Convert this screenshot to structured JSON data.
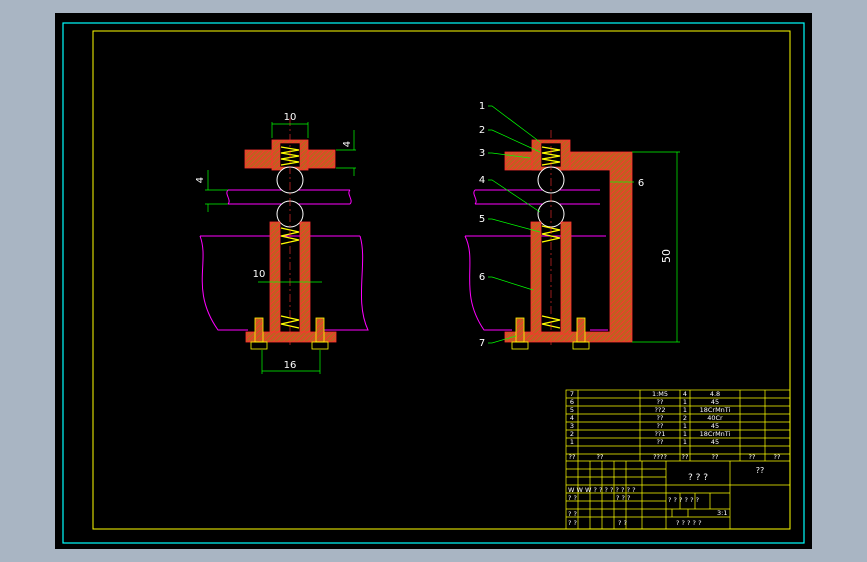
{
  "colors": {
    "app_bg": "#a9b5c3",
    "canvas": "#000000",
    "frame_outer": "#00ffff",
    "frame_inner": "#ffff00",
    "body_fill": "#c06020",
    "hatch": "#ff3030",
    "spring": "#ffff00",
    "ball_outline": "#ffffff",
    "workpiece": "#ff00ff",
    "dimension": "#00ff00",
    "leader": "#00ff00",
    "text": "#ffffff",
    "title_block": "#ffff00"
  },
  "left_view": {
    "dim_top_width": "10",
    "dim_right": "4",
    "dim_left": "4",
    "dim_center": "10",
    "dim_bottom": "16"
  },
  "right_view": {
    "callouts": [
      "1",
      "2",
      "3",
      "4",
      "5",
      "6",
      "7"
    ],
    "callout_bracket": "6",
    "dim_height": "50"
  },
  "title_block": {
    "parts": [
      {
        "no": "7",
        "name": "",
        "qty_label": "",
        "spec": "1:M5",
        "qty": "4",
        "material": "4.8"
      },
      {
        "no": "6",
        "name": "",
        "qty_label": "",
        "spec": "??",
        "qty": "1",
        "material": "45"
      },
      {
        "no": "5",
        "name": "",
        "qty_label": "",
        "spec": "??2",
        "qty": "1",
        "material": "18CrMnTi"
      },
      {
        "no": "4",
        "name": "",
        "qty_label": "",
        "spec": "??",
        "qty": "2",
        "material": "40Cr"
      },
      {
        "no": "3",
        "name": "",
        "qty_label": "",
        "spec": "??",
        "qty": "1",
        "material": "45"
      },
      {
        "no": "2",
        "name": "",
        "qty_label": "",
        "spec": "??1",
        "qty": "1",
        "material": "18CrMnTi"
      },
      {
        "no": "1",
        "name": "",
        "qty_label": "",
        "spec": "??",
        "qty": "1",
        "material": "45"
      }
    ],
    "header": {
      "no": "??",
      "name": "??",
      "spec": "????",
      "qty": "??",
      "material": "??",
      "c6": "??",
      "c7": "??"
    },
    "drawing_title": "? ? ?",
    "drawing_code": "??",
    "label_a": "? ?",
    "label_b": "? ?",
    "label_c": "? ?",
    "label_d": "? ?",
    "row_chars": "W W W ? ? ? ? ? ? ? ?",
    "mid_chars": "? ? ?",
    "scale_chars": "? ?  ? ?  ? ?",
    "scale_value": "3:1",
    "bottom_chars": "? ?  ? ?  ?"
  }
}
